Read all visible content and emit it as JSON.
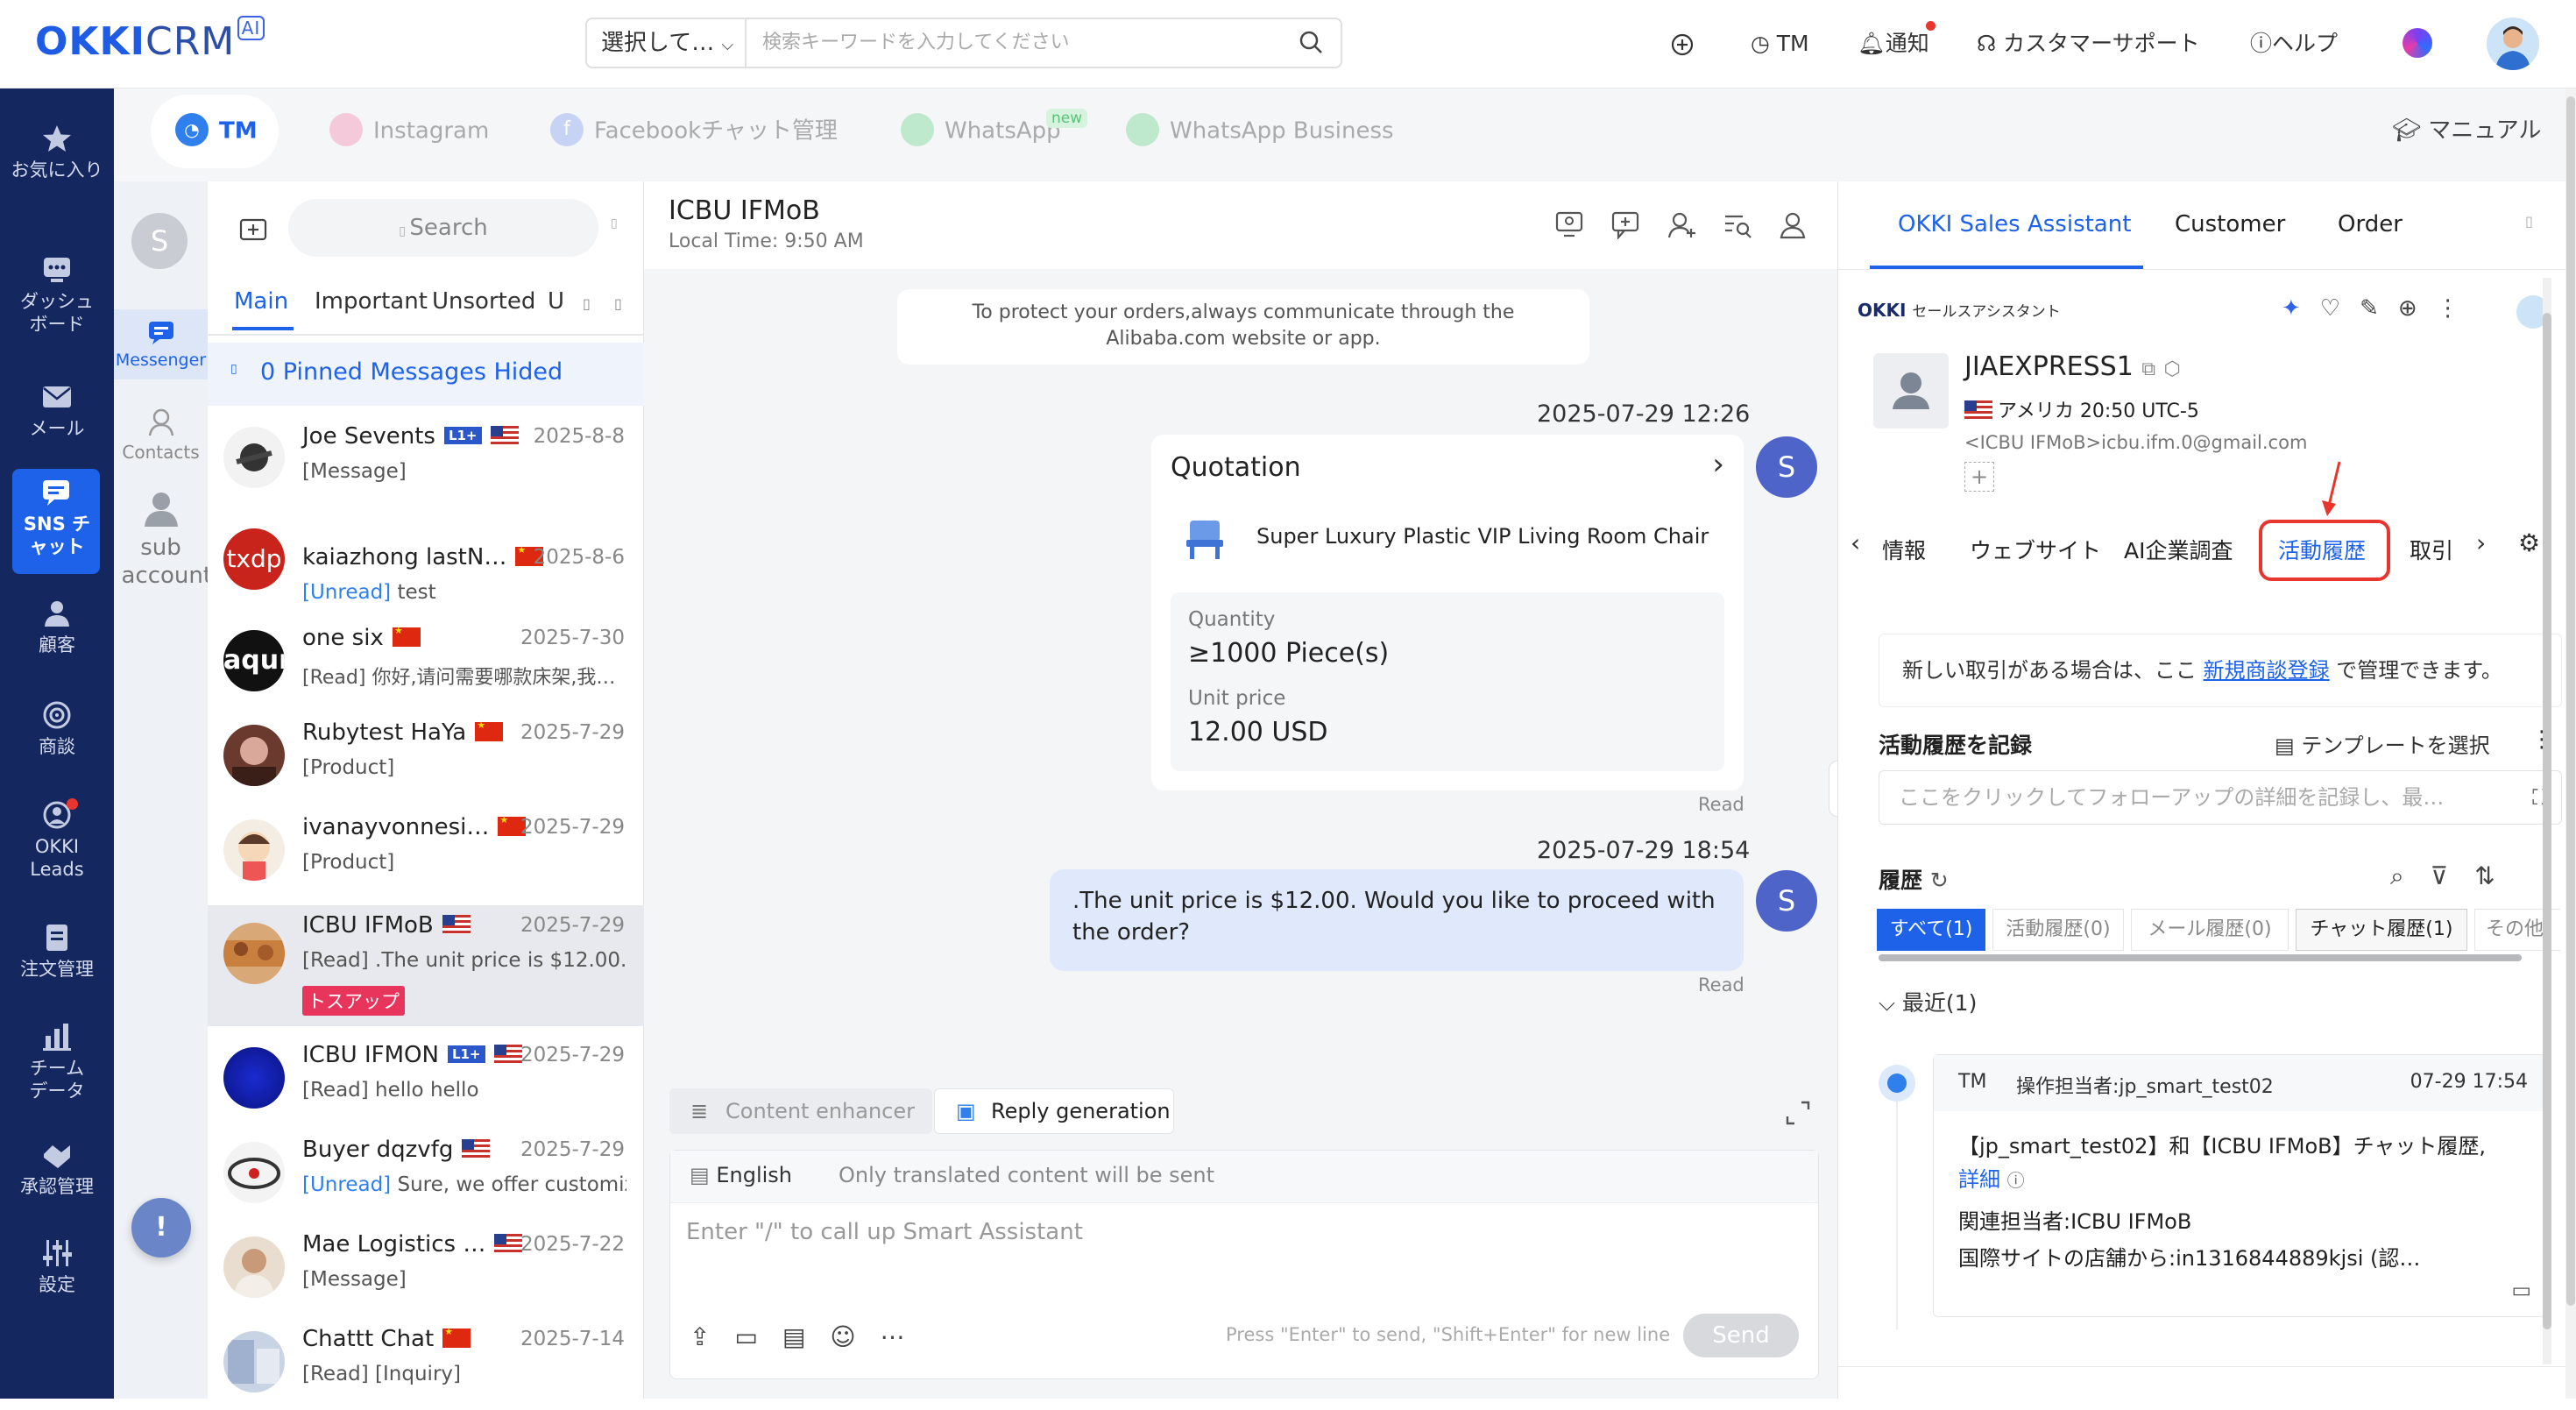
{
  "topbar": {
    "logo_main": "OKKI",
    "logo_sub": "CRM",
    "logo_ai": "AI",
    "search_select": "選択して…",
    "search_placeholder": "検索キーワードを入力してください",
    "tm": "TM",
    "notify": "通知",
    "support": "カスタマーサポート",
    "help": "ヘルプ"
  },
  "leftnav": {
    "items": [
      {
        "label": "お気に入り",
        "icon": "star-icon"
      },
      {
        "label": "ダッシュボード",
        "icon": "dashboard-icon"
      },
      {
        "label": "メール",
        "icon": "mail-icon"
      },
      {
        "label": "SNS チャット",
        "icon": "chat-icon"
      },
      {
        "label": "顧客",
        "icon": "customers-icon"
      },
      {
        "label": "商談",
        "icon": "deal-icon"
      },
      {
        "label": "OKKI Leads",
        "icon": "leads-icon"
      },
      {
        "label": "注文管理",
        "icon": "order-icon"
      },
      {
        "label": "チームデータ",
        "icon": "team-data-icon"
      },
      {
        "label": "承認管理",
        "icon": "approval-icon"
      },
      {
        "label": "設定",
        "icon": "settings-icon"
      }
    ]
  },
  "subnav": {
    "avatar": "S",
    "messenger": "Messenger",
    "contacts": "Contacts",
    "sub_account": "sub account"
  },
  "channel_tabs": [
    "TM",
    "Instagram",
    "Facebookチャット管理",
    "WhatsApp",
    "WhatsApp Business"
  ],
  "channel_new_badge": "new",
  "manual": "マニュアル",
  "convlist": {
    "search": "Search",
    "tabs": [
      "Main",
      "Important",
      "Unsorted",
      "U"
    ],
    "pinned": "0 Pinned Messages Hided",
    "items": [
      {
        "name": "Joe Sevents",
        "badge": "L1+",
        "flag": "us",
        "date": "2025-8-8",
        "tag": "",
        "preview": "[Message]"
      },
      {
        "name": "kaiazhong lastN…",
        "badge": "",
        "flag": "cn",
        "date": "2025-8-6",
        "tag": "[Unread]",
        "preview": "test"
      },
      {
        "name": "one six",
        "badge": "",
        "flag": "cn",
        "date": "2025-7-30",
        "tag": "",
        "preview": "[Read] 你好,请问需要哪款床架,我…"
      },
      {
        "name": "Rubytest HaYa",
        "badge": "",
        "flag": "cn",
        "date": "2025-7-29",
        "tag": "",
        "preview": "[Product]"
      },
      {
        "name": "ivanayvonnesi…",
        "badge": "",
        "flag": "cn",
        "date": "2025-7-29",
        "tag": "",
        "preview": "[Product]"
      },
      {
        "name": "ICBU IFMoB",
        "badge": "",
        "flag": "us",
        "date": "2025-7-29",
        "tag": "",
        "preview": "[Read] .The unit price is $12.00. …"
      },
      {
        "name": "ICBU IFMON",
        "badge": "L1+",
        "flag": "us",
        "date": "2025-7-29",
        "tag": "",
        "preview": "[Read] hello hello"
      },
      {
        "name": "Buyer dqzvfg",
        "badge": "",
        "flag": "us",
        "date": "2025-7-29",
        "tag": "[Unread]",
        "preview": "Sure, we offer customiz…"
      },
      {
        "name": "Mae Logistics …",
        "badge": "",
        "flag": "us",
        "date": "2025-7-22",
        "tag": "",
        "preview": "[Message]"
      },
      {
        "name": "Chattt Chat",
        "badge": "",
        "flag": "cn",
        "date": "2025-7-14",
        "tag": "",
        "preview": "[Read] [Inquiry]"
      }
    ],
    "followup_tag": "トスアップ",
    "avatar_text_txdp": "txdp",
    "avatar_text_aqur": "aqur"
  },
  "chat": {
    "title": "ICBU IFMoB",
    "local_time": "Local Time: 9:50 AM",
    "notice": "To protect your orders,always communicate through the Alibaba.com website or app.",
    "ts1": "2025-07-29 12:26",
    "quotation_title": "Quotation",
    "product": "Super Luxury Plastic VIP Living Room Chair",
    "qty_label": "Quantity",
    "qty_value": "≥1000 Piece(s)",
    "price_label": "Unit price",
    "price_value": "12.00 USD",
    "read1": "Read",
    "ts2": "2025-07-29 18:54",
    "msg2": ".The unit price is $12.00. Would you like to proceed with the order?",
    "read2": "Read",
    "sender_avatar": "S",
    "content_enhancer": "Content enhancer",
    "reply_generation": "Reply generation",
    "language": "English",
    "translate_note": "Only translated content will be sent",
    "input_placeholder": "Enter \"/\" to call up Smart Assistant",
    "send_hint": "Press \"Enter\" to send, \"Shift+Enter\" for new line",
    "send": "Send"
  },
  "right": {
    "tabs": [
      "OKKI Sales Assistant",
      "Customer",
      "Order"
    ],
    "brand": "OKKI",
    "brand_sub": "セールスアシスタント",
    "customer_name": "JIAEXPRESS1",
    "customer_loc": "アメリカ 20:50 UTC-5",
    "customer_email": "<ICBU IFMoB>icbu.ifm.0@gmail.com",
    "subtabs": [
      "情報",
      "ウェブサイト",
      "AI企業調査",
      "活動履歴",
      "取引"
    ],
    "deal_note_a": "新しい取引がある場合は、ここ",
    "deal_link": "新規商談登録",
    "deal_note_b": "で管理できます。",
    "record_title": "活動履歴を記録",
    "template": "テンプレートを選択",
    "record_placeholder": "ここをクリックしてフォローアップの詳細を記録し、最…",
    "history_title": "履歴",
    "filters": [
      "すべて(1)",
      "活動履歴(0)",
      "メール履歴(0)",
      "チャット履歴(1)",
      "その他("
    ],
    "recent": "最近(1)",
    "card_src": "TM",
    "card_operator": "操作担当者:jp_smart_test02",
    "card_time": "07-29 17:54",
    "card_line1": "【jp_smart_test02】和【ICBU IFMoB】チャット履歴,",
    "card_detail": "詳細",
    "card_line2": "関連担当者:ICBU IFMoB",
    "card_line3": "国際サイトの店舗から:in1316844889kjsi (認…"
  },
  "colors": {
    "brand_blue": "#1d62e8",
    "nav_bg": "#15275f",
    "highlight_red": "#e8352d"
  }
}
